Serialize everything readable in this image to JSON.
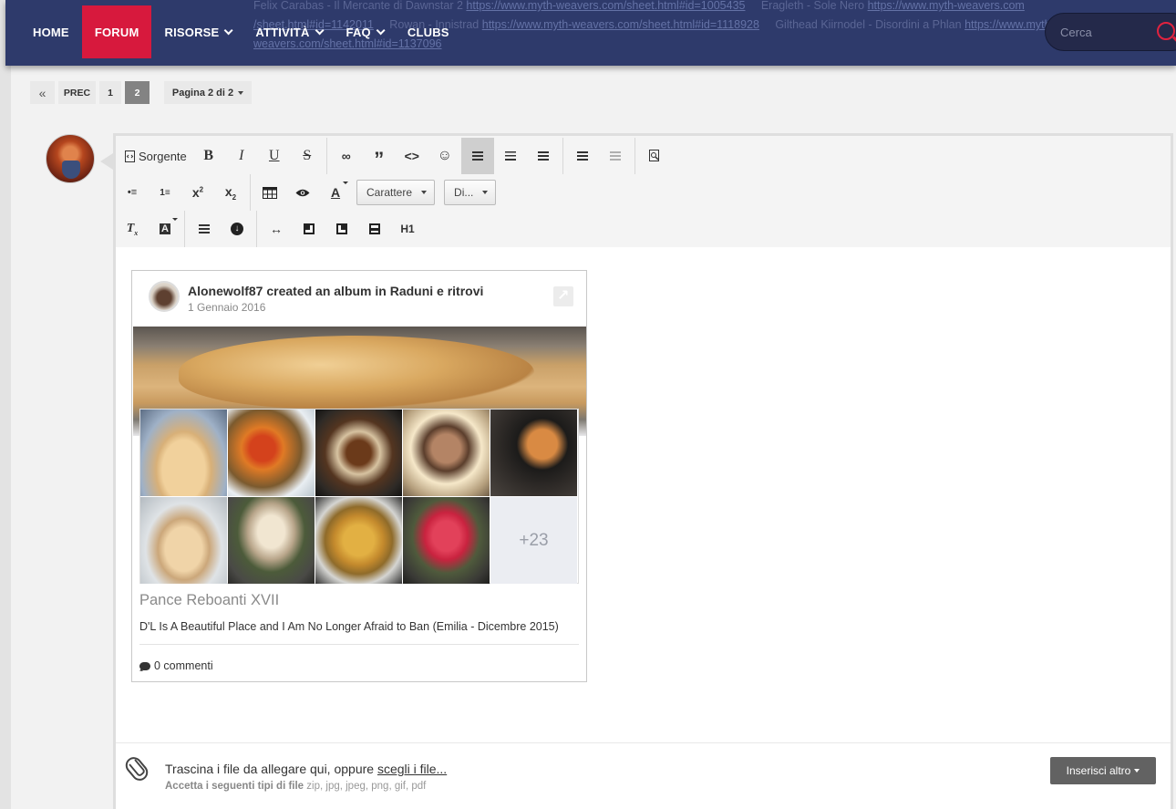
{
  "nav": {
    "items": [
      {
        "label": "HOME",
        "has_dropdown": false,
        "active": false
      },
      {
        "label": "FORUM",
        "has_dropdown": false,
        "active": true
      },
      {
        "label": "RISORSE",
        "has_dropdown": true,
        "active": false
      },
      {
        "label": "ATTIVITÀ",
        "has_dropdown": true,
        "active": false
      },
      {
        "label": "FAQ",
        "has_dropdown": true,
        "active": false
      },
      {
        "label": "CLUBS",
        "has_dropdown": false,
        "active": false
      }
    ],
    "background_text_line1": "Felix Carabas - Il Mercante di Dawnstar 2 ",
    "background_link1": "https://www.myth-weavers.com/sheet.html#id=1005435",
    "background_text_line1b": "     Eragleth - Sole Nero ",
    "background_link2": "https://www.myth-weavers.com",
    "background_link2b": "/sheet.html#id=1142011",
    "background_text_line2": "     Rowan - Innistrad ",
    "background_link3": "https://www.myth-weavers.com/sheet.html#id=1118928",
    "background_text_line2b": "     Gilthead Kiirnodel - Disordini a Phlan ",
    "background_link4": "https://www.myth-",
    "background_link4b": "weavers.com/sheet.html#id=1137096",
    "search_placeholder": "Cerca",
    "colors": {
      "bar": "#2e3a6b",
      "active": "#d7193d",
      "search_icon": "#e0223f"
    }
  },
  "pagination": {
    "first_icon": "«",
    "prev_label": "PREC",
    "pages": [
      "1",
      "2"
    ],
    "current_page": "2",
    "page_jump_label": "Pagina 2 di 2"
  },
  "editor": {
    "toolbar": {
      "source_label": "Sorgente",
      "font_dropdown": "Carattere",
      "size_dropdown": "Di...",
      "heading_label": "H1"
    },
    "embed": {
      "title": "Alonewolf87 created an album in Raduni e ritrovi",
      "date": "1 Gennaio 2016",
      "more_count": "+23",
      "album_name": "Pance Reboanti XVII",
      "album_description": "D'L Is A Beautiful Place and I Am No Longer Afraid to Ban (Emilia - Dicembre 2015)",
      "comments_label": "0 commenti"
    },
    "attach": {
      "drop_text": "Trascina i file da allegare qui, oppure ",
      "choose_link": "scegli i file...",
      "types_label": "Accetta i seguenti tipi di file",
      "types_list": "zip, jpg, jpeg, png, gif, pdf",
      "insert_button": "Inserisci altro"
    }
  }
}
